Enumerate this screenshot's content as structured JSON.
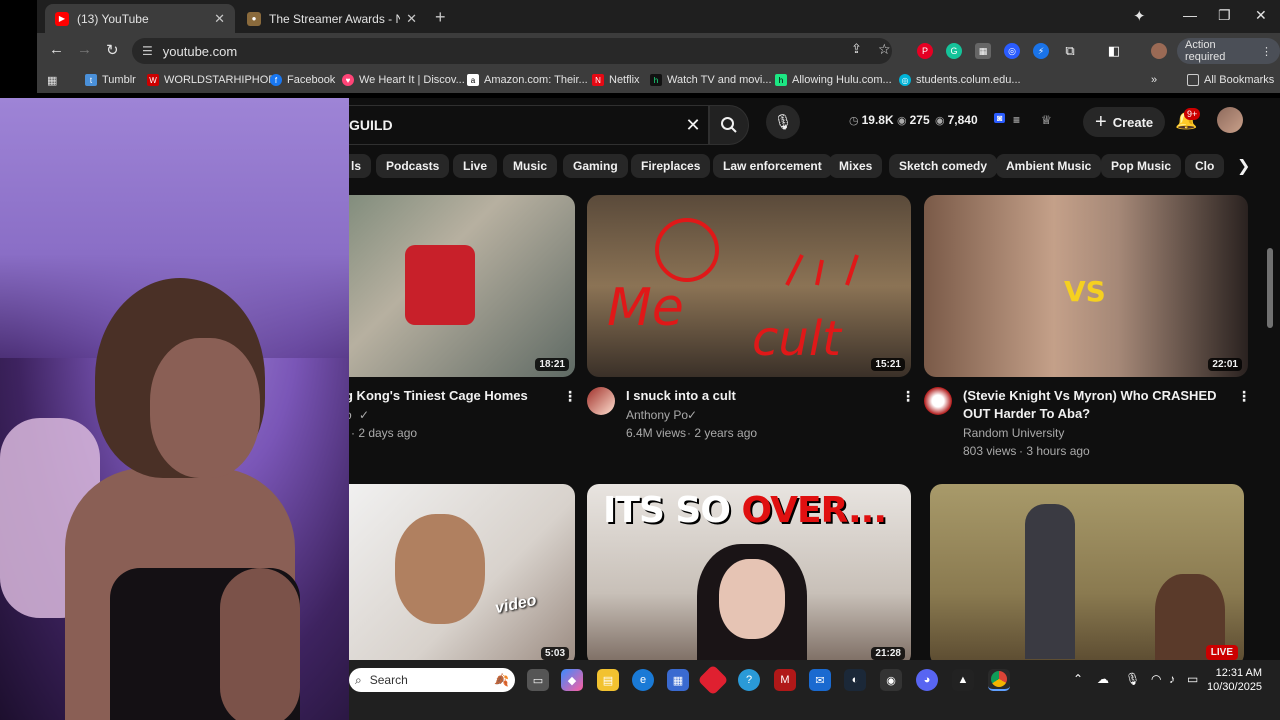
{
  "browser": {
    "tabs": [
      {
        "label": "(13) YouTube",
        "icon": "youtube-icon"
      },
      {
        "label": "The Streamer Awards - Nomina",
        "icon": "streamer-awards-icon"
      }
    ],
    "url": "youtube.com",
    "action_required": "Action required",
    "bookmarks": [
      {
        "label": "Tumblr",
        "color": "#4a90d9"
      },
      {
        "label": "WORLDSTARHIPHOP",
        "color": "#cc0000"
      },
      {
        "label": "Facebook",
        "color": "#1877f2"
      },
      {
        "label": "We Heart It | Discov...",
        "color": "#ff4477"
      },
      {
        "label": "Amazon.com: Their...",
        "color": "#ffffff"
      },
      {
        "label": "Netflix",
        "color": "#e50914"
      },
      {
        "label": "Watch TV and movi...",
        "color": "#1ce783"
      },
      {
        "label": "Allowing Hulu.com...",
        "color": "#1ce783"
      },
      {
        "label": "students.colum.edu...",
        "color": "#00b4d8"
      }
    ],
    "all_bookmarks": "All Bookmarks"
  },
  "youtube": {
    "search_value": "GUILD",
    "stats": [
      {
        "icon": "clock-icon",
        "value": "19.8K"
      },
      {
        "icon": "eye-icon",
        "value": "275"
      },
      {
        "icon": "eye-icon",
        "value": "7,840"
      }
    ],
    "create_label": "Create",
    "notification_badge": "9+",
    "chips": [
      "ls",
      "Podcasts",
      "Live",
      "Music",
      "Gaming",
      "Fireplaces",
      "Law enforcement",
      "Mixes",
      "Sketch comedy",
      "Ambient Music",
      "Pop Music",
      "Clo"
    ],
    "videos": [
      {
        "title": "g Kong's Tiniest Cage Homes",
        "channel": "o",
        "views": "",
        "age": "· 2 days ago",
        "duration": "18:21"
      },
      {
        "title": "I snuck into a cult",
        "channel": "Anthony Po",
        "views": "6.4M views",
        "age": "· 2 years ago",
        "duration": "15:21"
      },
      {
        "title": "(Stevie Knight Vs Myron) Who CRASHED OUT Harder To Aba?",
        "channel": "Random University",
        "views": "803 views",
        "age": "· 3 hours ago",
        "duration": "22:01"
      },
      {
        "duration": "5:03",
        "thumb_text": "video"
      },
      {
        "duration": "21:28",
        "thumb_text_a": "ITS SO ",
        "thumb_text_b": "OVER..."
      },
      {
        "live_label": "LIVE"
      }
    ]
  },
  "taskbar": {
    "search_placeholder": "Search",
    "time": "12:31 AM",
    "date": "10/30/2025"
  }
}
